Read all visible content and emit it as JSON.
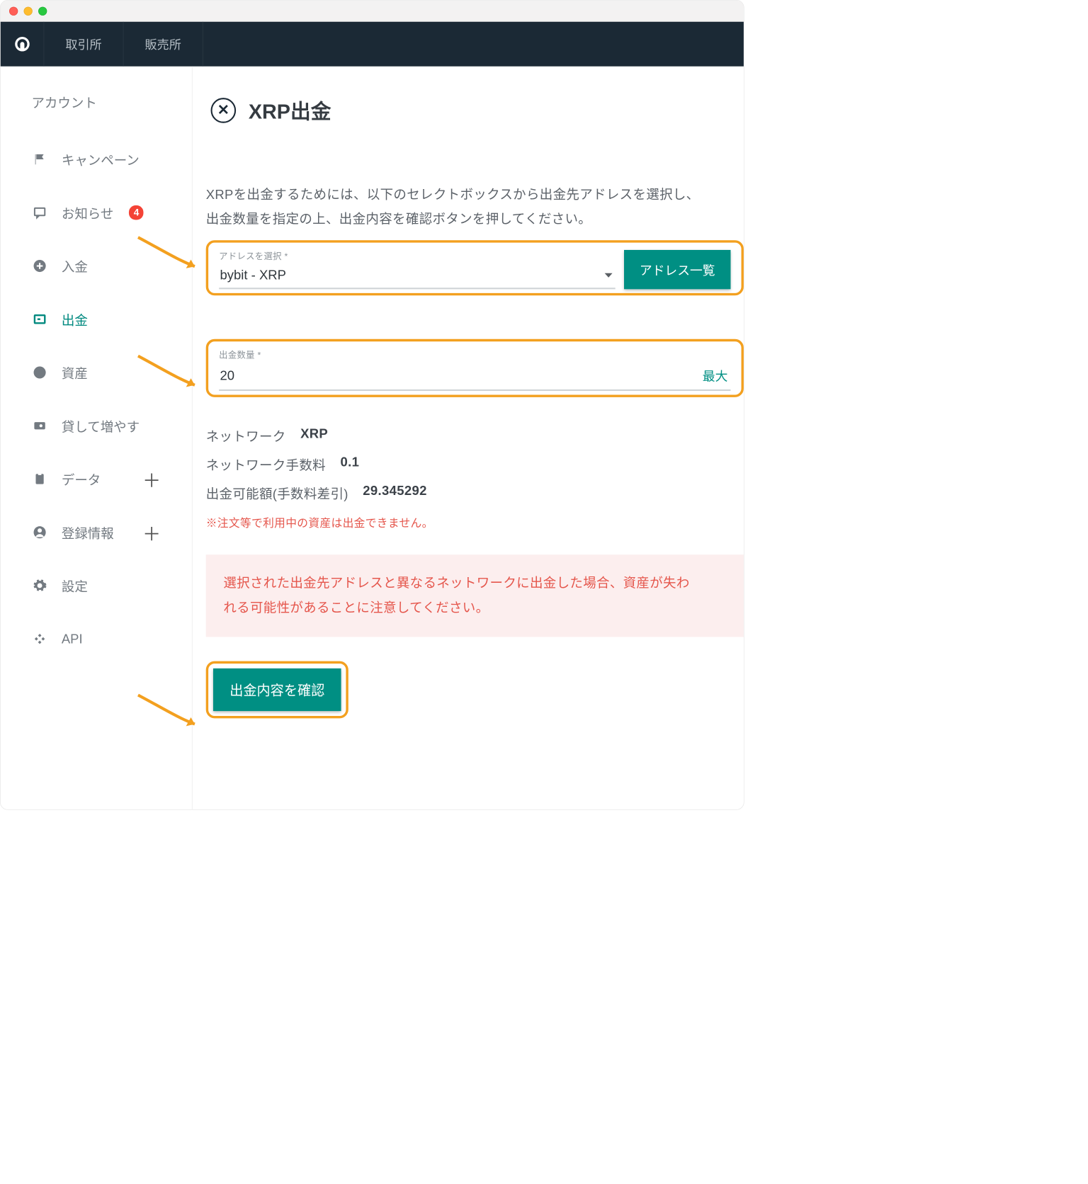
{
  "topnav": {
    "items": [
      "取引所",
      "販売所"
    ]
  },
  "sidebar": {
    "title": "アカウント",
    "items": [
      {
        "label": "キャンペーン"
      },
      {
        "label": "お知らせ",
        "badge": "4"
      },
      {
        "label": "入金"
      },
      {
        "label": "出金",
        "active": true
      },
      {
        "label": "資産"
      },
      {
        "label": "貸して増やす"
      },
      {
        "label": "データ",
        "expand": true
      },
      {
        "label": "登録情報",
        "expand": true
      },
      {
        "label": "設定"
      },
      {
        "label": "API"
      }
    ]
  },
  "page": {
    "crypto_symbol": "✕",
    "title": "XRP出金",
    "desc1": "XRPを出金するためには、以下のセレクトボックスから出金先アドレスを選択し、",
    "desc2": "出金数量を指定の上、出金内容を確認ボタンを押してください。"
  },
  "address": {
    "label": "アドレスを選択 *",
    "selected": "bybit - XRP",
    "list_button": "アドレス一覧"
  },
  "amount": {
    "label": "出金数量 *",
    "value": "20",
    "max_button": "最大"
  },
  "info": {
    "network_label": "ネットワーク",
    "network_value": "XRP",
    "fee_label": "ネットワーク手数料",
    "fee_value": "0.1",
    "available_label": "出金可能額(手数料差引)",
    "available_value": "29.345292"
  },
  "warn_text": "※注文等で利用中の資産は出金できません。",
  "alert_line1": "選択された出金先アドレスと異なるネットワークに出金した場合、資産が失わ",
  "alert_line2": "れる可能性があることに注意してください。",
  "submit_button": "出金内容を確認"
}
